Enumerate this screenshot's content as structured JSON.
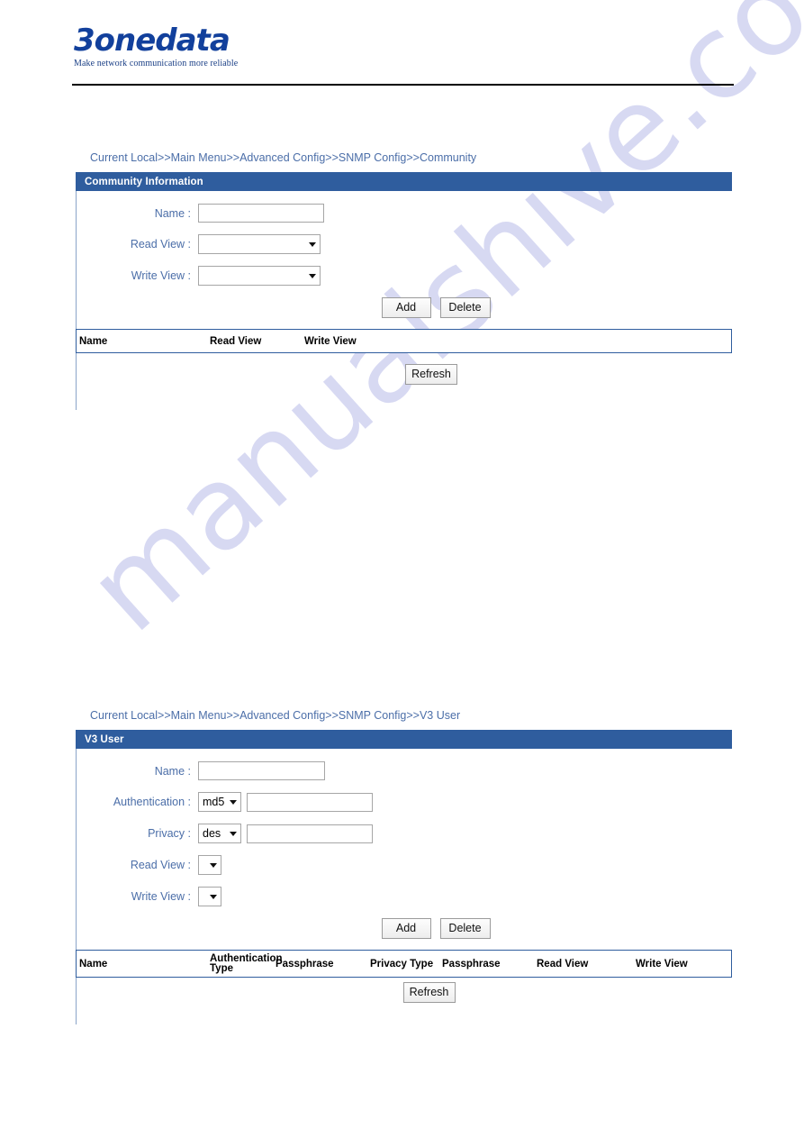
{
  "branding": {
    "logo_text": "3onedata",
    "tagline": "Make network communication more reliable"
  },
  "watermark": {
    "text": "manualshive.com"
  },
  "colors": {
    "panel_header_bg": "#2f5d9e",
    "label_text": "#4b6ea8",
    "breadcrumb_text": "#4b6ea8",
    "table_border": "#2f5d9e",
    "logo_blue": "#12409c",
    "watermark": "#c9cbee"
  },
  "sections": [
    {
      "id": "community",
      "breadcrumb": "Current Local>>Main Menu>>Advanced Config>>SNMP Config>>Community",
      "panel_title": "Community Information",
      "fields": {
        "name_label": "Name :",
        "name_value": "",
        "name_placeholder": "",
        "read_view_label": "Read View :",
        "read_view_value": "",
        "write_view_label": "Write View :",
        "write_view_value": ""
      },
      "buttons": {
        "add": "Add",
        "delete": "Delete",
        "refresh": "Refresh"
      },
      "table": {
        "columns": [
          "Name",
          "Read View",
          "Write View"
        ],
        "rows": []
      }
    },
    {
      "id": "v3user",
      "breadcrumb": "Current Local>>Main Menu>>Advanced Config>>SNMP Config>>V3 User",
      "panel_title": "V3 User",
      "fields": {
        "name_label": "Name :",
        "name_value": "",
        "authentication_label": "Authentication :",
        "authentication_type_value": "md5",
        "authentication_passphrase_value": "",
        "privacy_label": "Privacy :",
        "privacy_type_value": "des",
        "privacy_passphrase_value": "",
        "read_view_label": "Read View :",
        "read_view_value": "",
        "write_view_label": "Write View :",
        "write_view_value": ""
      },
      "buttons": {
        "add": "Add",
        "delete": "Delete",
        "refresh": "Refresh"
      },
      "table": {
        "columns": [
          "Name",
          "Authentication Type",
          "Passphrase",
          "Privacy Type",
          "Passphrase",
          "Read View",
          "Write View"
        ],
        "rows": []
      }
    }
  ]
}
